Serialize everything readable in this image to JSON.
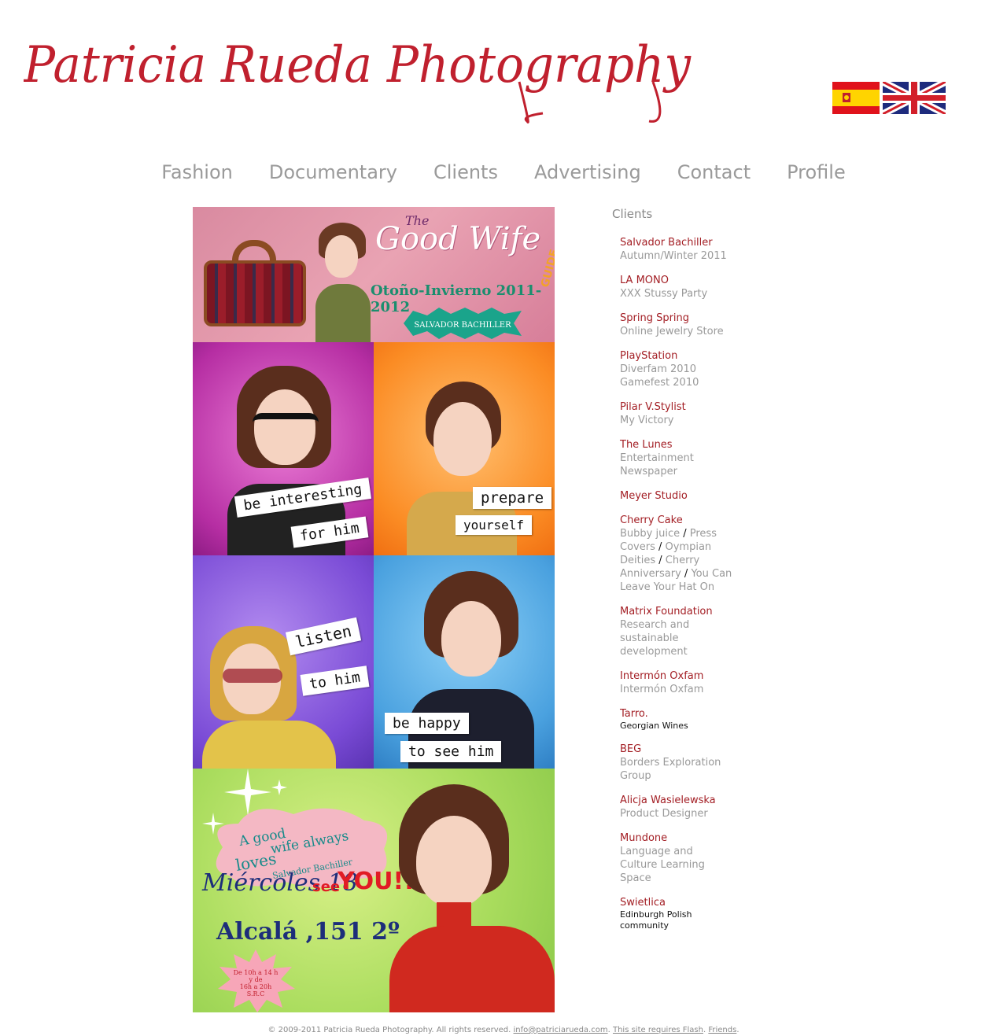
{
  "header": {
    "logo_text": "Patricia Rueda Photography",
    "flags": [
      {
        "name": "spanish-flag-icon",
        "lang": "Spanish"
      },
      {
        "name": "uk-flag-icon",
        "lang": "English"
      }
    ]
  },
  "nav": {
    "items": [
      "Fashion",
      "Documentary",
      "Clients",
      "Advertising",
      "Contact",
      "Profile"
    ]
  },
  "poster": {
    "top": {
      "the": "The",
      "title": "Good Wife",
      "guide": "GUIDE",
      "season": "Otoño-Invierno 2011-2012",
      "badge": "SALVADOR BACHILLER"
    },
    "panel_magenta": {
      "sign1": "be interesting",
      "sign2": "for him"
    },
    "panel_orange": {
      "sign1": "prepare",
      "sign2": "yourself"
    },
    "panel_purple": {
      "sign1": "listen",
      "sign2": "to him"
    },
    "panel_blue": {
      "sign1": "be happy",
      "sign2": "to see him"
    },
    "panel_green": {
      "cloud_line1": "A good",
      "cloud_line2": "wife always",
      "cloud_line3": "loves",
      "cloud_brand": "Salvador Bachiller",
      "date": "Miércoles 18",
      "see": "see",
      "you": "YOU!!",
      "address": "Alcalá ,151 2º",
      "hours_line1": "De 10h a 14 h",
      "hours_line2": "y de",
      "hours_line3": "16h a 20h",
      "hours_line4": "S.R.C"
    }
  },
  "sidebar": {
    "heading": "Clients",
    "clients": [
      {
        "name": "Salvador Bachiller",
        "desc": [
          "Autumn/Winter 2011"
        ]
      },
      {
        "name": "LA MONO",
        "desc": [
          "XXX Stussy Party"
        ]
      },
      {
        "name": "Spring Spring",
        "desc": [
          "Online Jewelry Store"
        ]
      },
      {
        "name": "PlayStation",
        "desc": [
          "Diverfam 2010",
          "Gamefest 2010"
        ]
      },
      {
        "name": "Pilar V.Stylist",
        "desc": [
          "My Victory"
        ]
      },
      {
        "name": "The Lunes",
        "desc": [
          "Entertainment Newspaper"
        ]
      },
      {
        "name": "Meyer Studio",
        "desc": []
      },
      {
        "name": "Cherry Cake",
        "projects": [
          "Bubby juice",
          "Press Covers",
          "Oympian Deities",
          "Cherry Anniversary",
          "You Can Leave Your Hat On"
        ]
      },
      {
        "name": "Matrix Foundation",
        "desc": [
          "Research and sustainable development"
        ]
      },
      {
        "name": "Intermón Oxfam",
        "desc": [
          "Intermón Oxfam"
        ]
      },
      {
        "name": "Tarro.",
        "desc_dark": "Georgian Wines"
      },
      {
        "name": "BEG",
        "desc": [
          "Borders Exploration Group"
        ]
      },
      {
        "name": "Alicja Wasielewska",
        "desc": [
          "Product Designer"
        ]
      },
      {
        "name": "Mundone",
        "desc": [
          "Language and Culture Learning Space"
        ]
      },
      {
        "name": "Swietlica",
        "desc_dark": "Edinburgh Polish community"
      }
    ],
    "separator": " / "
  },
  "footer": {
    "copyright": "© 2009-2011 Patricia Rueda Photography. All rights reserved.",
    "email": "info@patriciarueda.com",
    "flash": "This site requires Flash",
    "friends": "Friends",
    "dot": "."
  },
  "colors": {
    "logo_red": "#c0202e",
    "client_name": "#a31e24",
    "nav_text": "#9a9a9a",
    "muted_text": "#999999"
  }
}
